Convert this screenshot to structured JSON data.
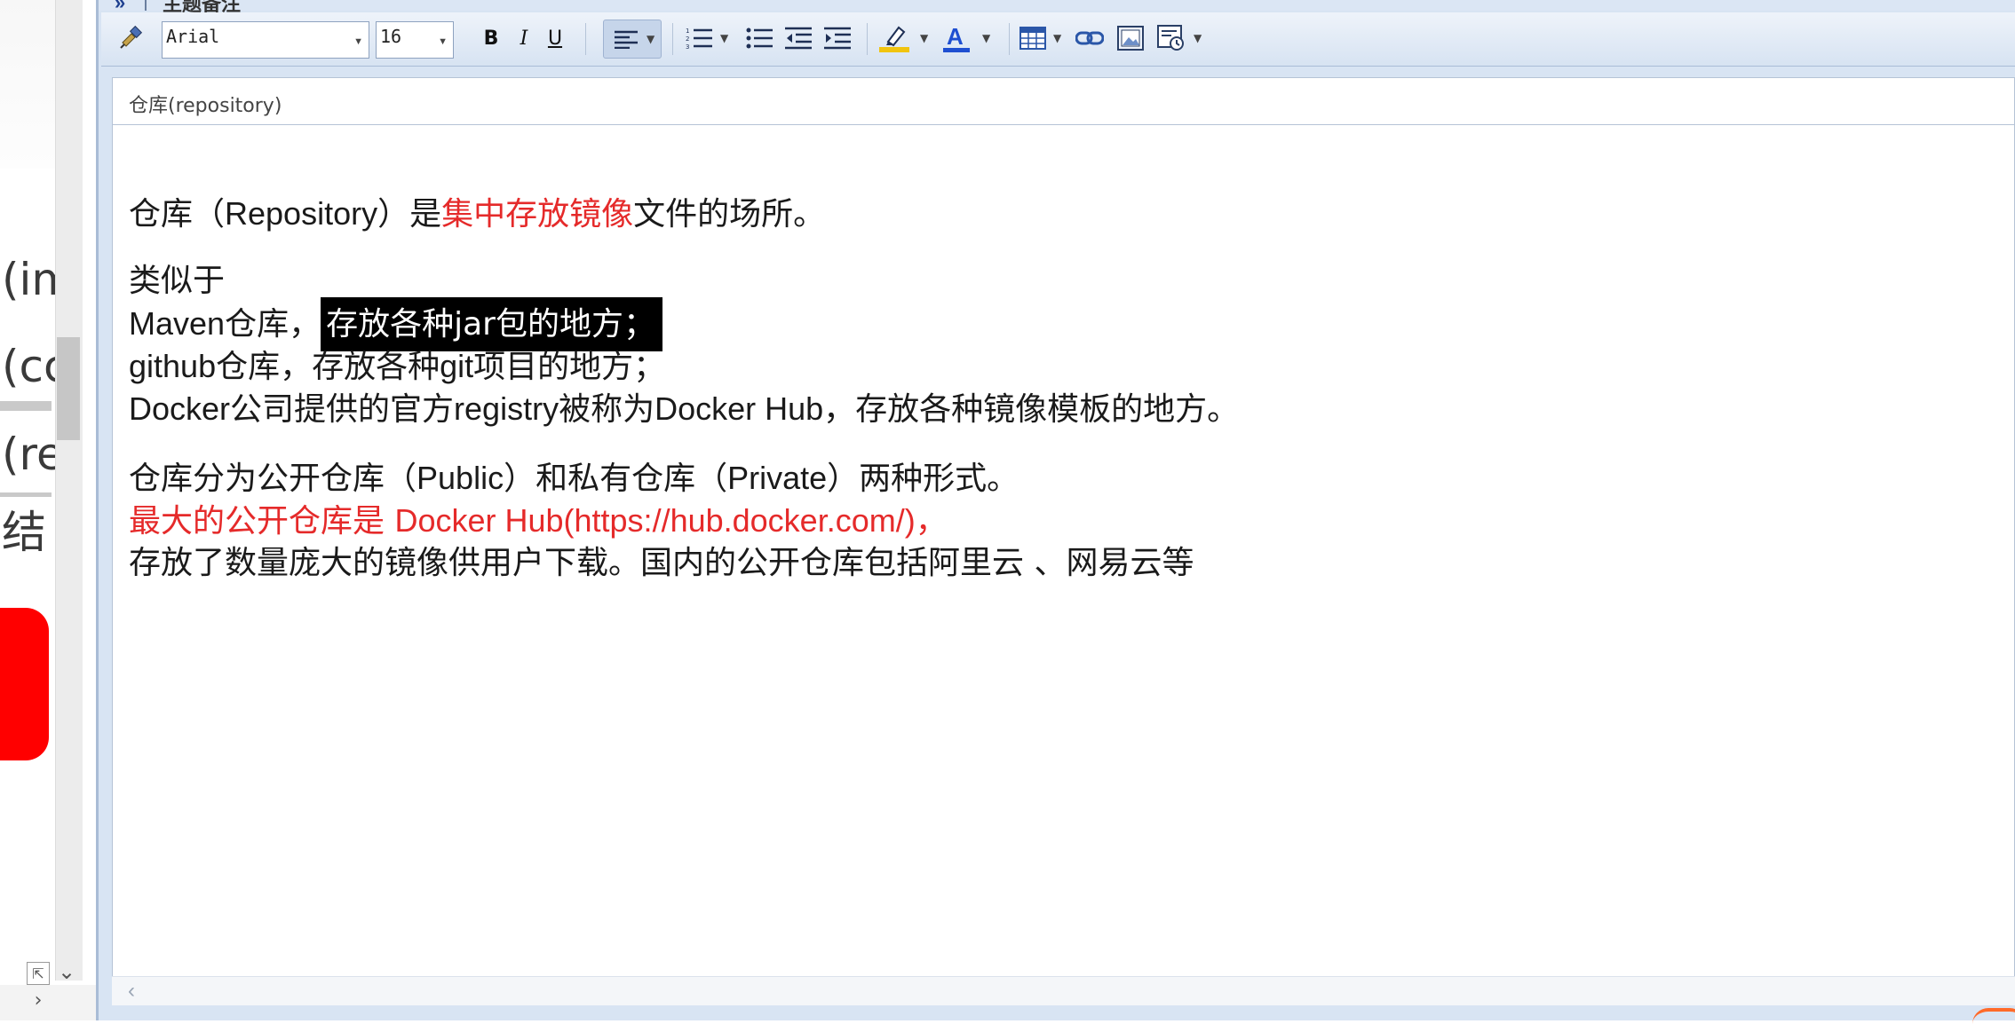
{
  "window": {
    "title": "主题备注"
  },
  "toolbar": {
    "font_family": "Arial",
    "font_size": "16",
    "bold_label": "B",
    "italic_label": "I",
    "underline_label": "U",
    "icons": [
      "format-painter-icon",
      "bold-icon",
      "italic-icon",
      "underline-icon",
      "align-left-icon",
      "numbered-list-icon",
      "bullet-list-icon",
      "decrease-indent-icon",
      "increase-indent-icon",
      "highlight-color-icon",
      "font-color-icon",
      "table-icon",
      "link-icon",
      "image-icon",
      "insert-object-icon"
    ],
    "highlight_color": "#f1c40f",
    "font_color": "#1f4fd1"
  },
  "title_field": {
    "value": "仓库(repository)"
  },
  "content": {
    "p1_a": "仓库（",
    "p1_b": "Repository",
    "p1_c": "）是",
    "p1_d": "集中存放镜像",
    "p1_e": "文件的场所。",
    "p2": "类似于",
    "p3_a": "Maven",
    "p3_b": "仓库，",
    "p3_sel": "存放各种jar包的地方；",
    "p4_a": "github",
    "p4_b": "仓库，存放各种",
    "p4_c": "git",
    "p4_d": "项目的地方；",
    "p5_a": "Docker",
    "p5_b": "公司提供的官方",
    "p5_c": "registry",
    "p5_d": "被称为",
    "p5_e": "Docker Hub",
    "p5_f": "，存放各种镜像模板的地方。",
    "p6_a": "仓库分为公开仓库（",
    "p6_b": "Public",
    "p6_c": "）和私有仓库（",
    "p6_d": "Private",
    "p6_e": "）两种形式。",
    "p7_a": "最大的公开仓库是 ",
    "p7_b": "Docker Hub(https://hub.docker.com/)",
    "p7_c": "，",
    "p8": "存放了数量庞大的镜像供用户下载。国内的公开仓库包括阿里云 、网易云等",
    "accent_red": "#e52a2a"
  },
  "left_panel": {
    "fragments": [
      "(im",
      "(cc",
      "(re",
      "结"
    ]
  }
}
